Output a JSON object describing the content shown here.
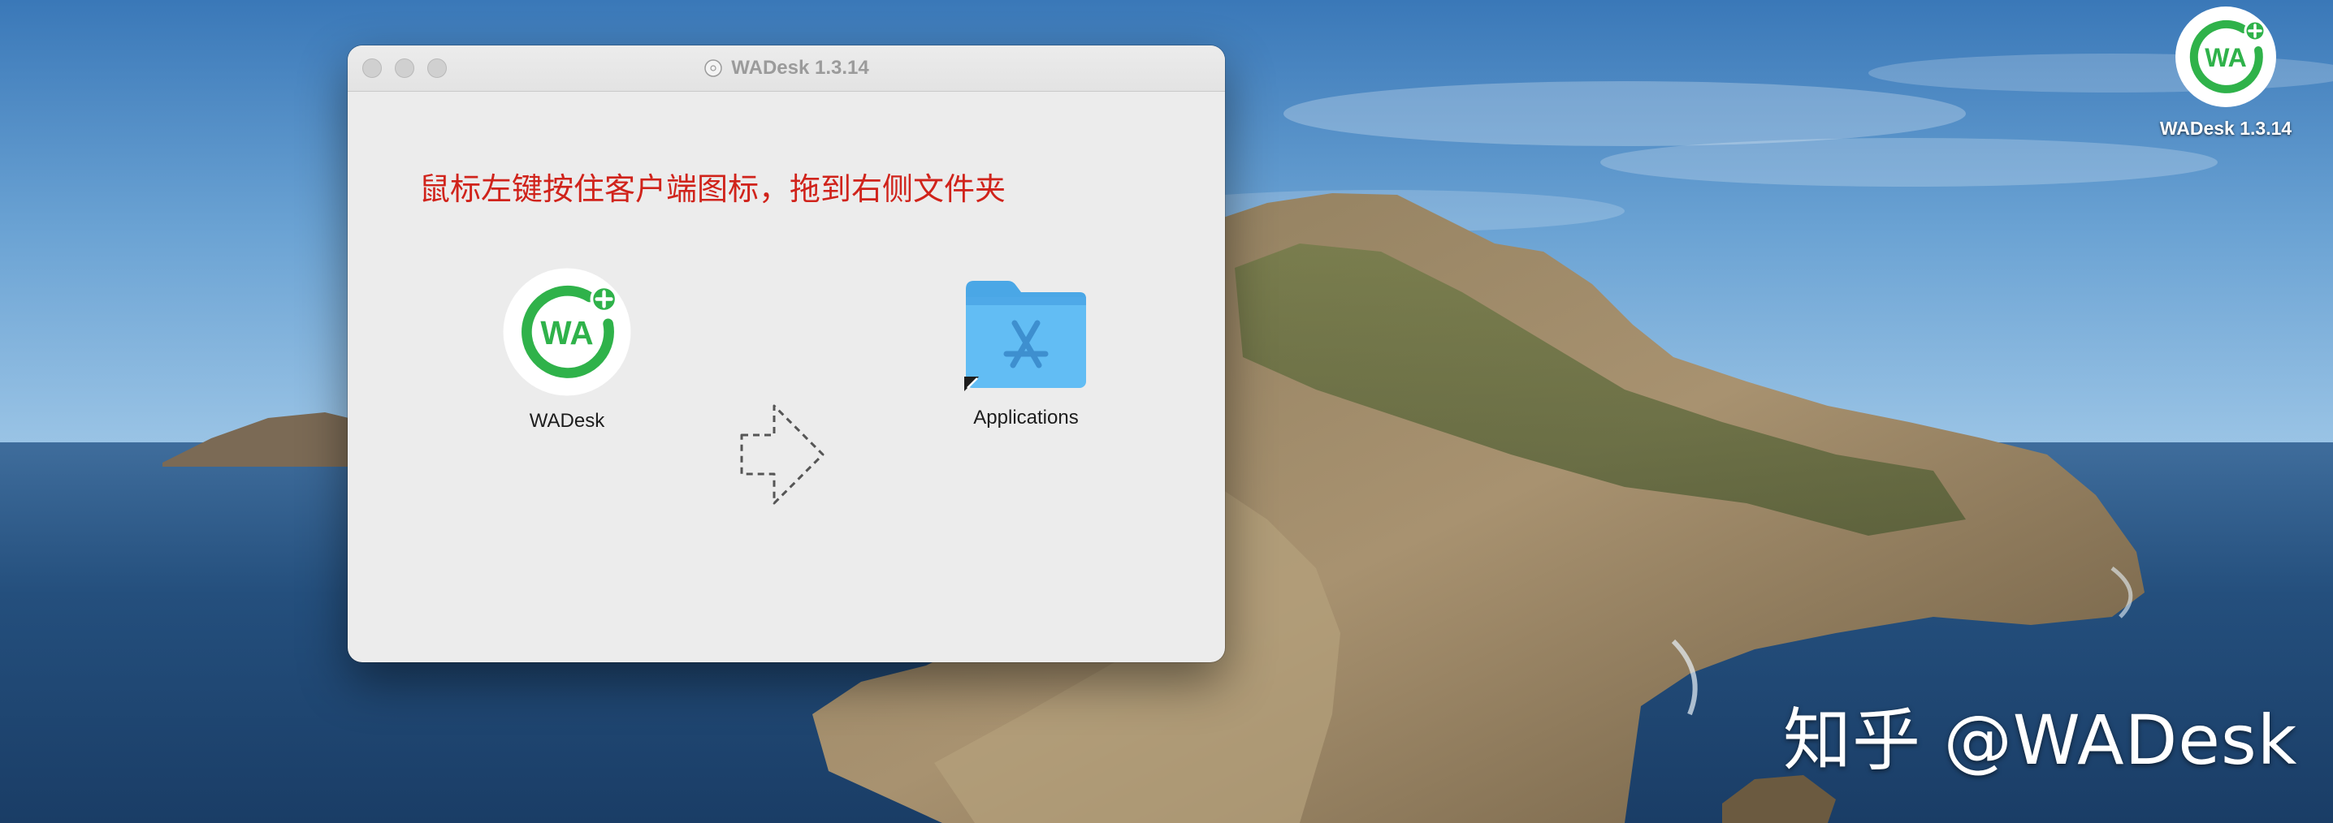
{
  "desktop": {
    "icon_label": "WADesk 1.3.14",
    "icon_name": "wadesk-app-icon"
  },
  "window": {
    "title": "WADesk 1.3.14",
    "instruction": "鼠标左键按住客户端图标，拖到右侧文件夹",
    "app_label": "WADesk",
    "folder_label": "Applications",
    "app_logo_text": "WA",
    "colors": {
      "instruction": "#d0231b",
      "logo_green": "#2fb24a",
      "folder_blue": "#5bb8f2"
    }
  },
  "watermark": {
    "text": "知乎 @WADesk"
  }
}
